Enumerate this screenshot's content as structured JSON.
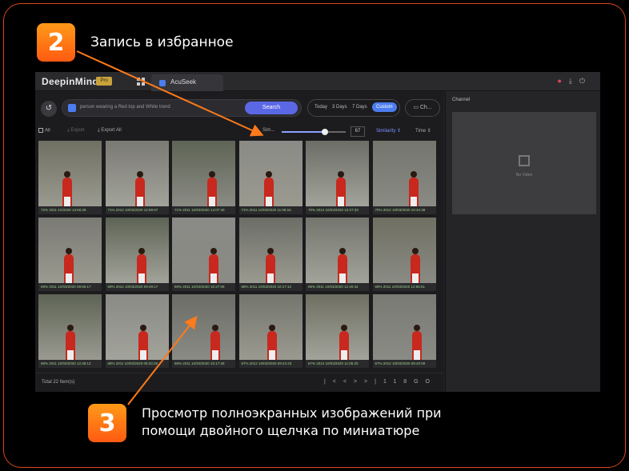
{
  "callouts": {
    "step2": {
      "number": "2",
      "text": "Запись в избранное"
    },
    "step3": {
      "number": "3",
      "line1": "Просмотр полноэкранных изображений при",
      "line2": "помощи двойного щелчка по миниатюре"
    }
  },
  "app": {
    "brand": "DeepinMind",
    "brand_badge": "Pro",
    "tab_label": "AcuSeek",
    "search": {
      "query": "person wearing a Red top and White trend",
      "button": "Search"
    },
    "time_range": {
      "options": [
        "Today",
        "3 Days",
        "7 Days",
        "Custom"
      ],
      "selected": "Custom"
    },
    "channel_button": "Ch...",
    "toolbar": {
      "all": "All",
      "export": "Export",
      "export_all": "Export All",
      "similarity_label": "Sim...",
      "similarity_value": "67",
      "similarity_level": 0.67,
      "sort_by": "Similarity",
      "time_sort": "Time"
    },
    "thumbnails": [
      {
        "caption": "72%  2011-10/2020 13:50:28"
      },
      {
        "caption": "71%  2012 10/03/2020 12:59:07"
      },
      {
        "caption": "71%  2011 10/03/2020 14:07:40"
      },
      {
        "caption": "71%  2011 10/03/2020 11:06:16"
      },
      {
        "caption": "70%  2012 10/03/2020 10:27:33"
      },
      {
        "caption": "70%  2012 10/03/2020 10:34:38"
      },
      {
        "caption": "69%  2011 10/03/2020 09:56:17"
      },
      {
        "caption": "69%  2012 10/03/2020 09:49:17"
      },
      {
        "caption": "69%  2011 10/03/2020 10:27:06"
      },
      {
        "caption": "69%  2011 10/03/2020 10:17:12"
      },
      {
        "caption": "69%  2011 10/03/2020 12:40:44"
      },
      {
        "caption": "69%  2011 10/03/2020 12:55:51"
      },
      {
        "caption": "68%  2011 10/03/2020 12:48:12"
      },
      {
        "caption": "68%  2011 10/03/2020 09:33:29"
      },
      {
        "caption": "68%  2011 10/03/2020 10:17:28"
      },
      {
        "caption": "67%  2012 10/03/2020 09:44:43"
      },
      {
        "caption": "67%  2012 10/03/2020 11:05:20"
      },
      {
        "caption": "67%  2012 10/03/2020 09:40:09"
      }
    ],
    "status": {
      "total": "Total 22 Item(s)",
      "page": "1",
      "page_size": "18",
      "go": "GO"
    },
    "side_panel": {
      "title": "Channel",
      "no_video": "No Video"
    }
  },
  "colors": {
    "accent_orange": "#ff6a13",
    "frame_border": "#d9471c",
    "app_blue": "#4c7df0"
  }
}
